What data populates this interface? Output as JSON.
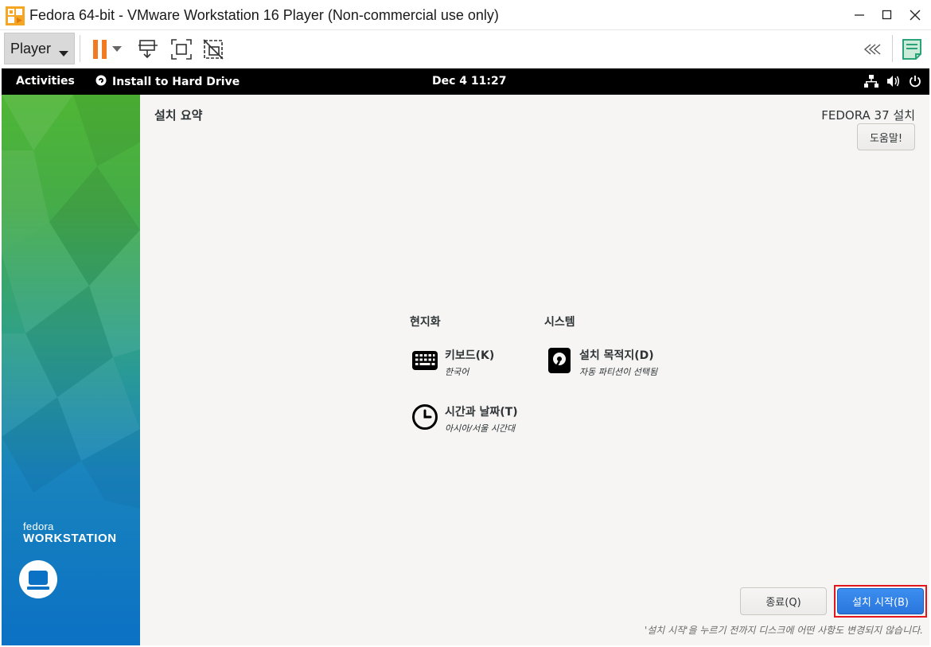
{
  "window": {
    "title": "Fedora 64-bit - VMware Workstation 16 Player (Non-commercial use only)",
    "icons": [
      "vmware-player-icon",
      "minimize-icon",
      "maximize-icon",
      "close-icon"
    ]
  },
  "toolbar": {
    "player_label": "Player",
    "icons": [
      "pause-icon",
      "dropdown-arrow-icon",
      "send-ctrl-alt-del-icon",
      "fullscreen-icon",
      "unity-icon",
      "collapse-toolbar-icon",
      "notes-icon"
    ],
    "colors": {
      "pause": "#f07b22",
      "notes": "#2aa37a"
    }
  },
  "gnome": {
    "activities": "Activities",
    "app_name": "Install to Hard Drive",
    "clock": "Dec 4  11:27",
    "tray_icons": [
      "network-icon",
      "volume-icon",
      "power-icon"
    ]
  },
  "sidebar": {
    "brand_fedora": "fedora",
    "brand_workstation": "WORKSTATION",
    "colors": {
      "top": "#4fb635",
      "bottom": "#0b71c4"
    }
  },
  "installer": {
    "page_title": "설치 요약",
    "product_title": "FEDORA 37 설치",
    "help_button": "도움말!",
    "categories": [
      {
        "title": "현지화",
        "spokes": [
          {
            "name": "키보드(K)",
            "status": "한국어",
            "icon": "keyboard-icon"
          },
          {
            "name": "시간과 날짜(T)",
            "status": "아시아/서울 시간대",
            "icon": "clock-icon"
          }
        ]
      },
      {
        "title": "시스템",
        "spokes": [
          {
            "name": "설치 목적지(D)",
            "status": "자동 파티션이 선택됨",
            "icon": "harddisk-icon"
          }
        ]
      }
    ],
    "quit_button": "종료(Q)",
    "begin_button": "설치 시작(B)",
    "footer_note": "'설치 시작'을 누르기 전까지 디스크에 어떤 사항도 변경되지 않습니다.",
    "colors": {
      "begin_button": "#3584e4",
      "highlight_outline": "#e3151d"
    }
  }
}
